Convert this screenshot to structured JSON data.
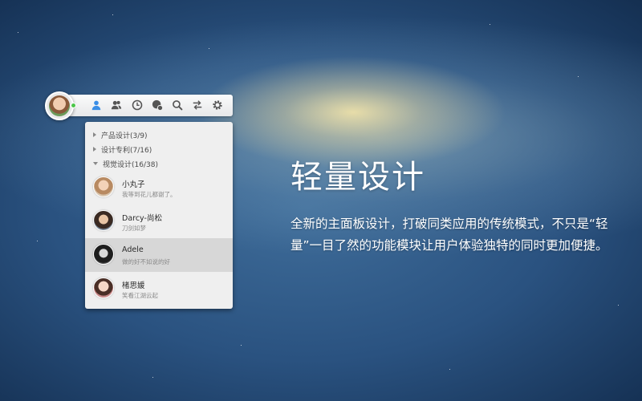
{
  "toolbar": {
    "icons": [
      "contacts-icon",
      "groups-icon",
      "recent-icon",
      "messages-icon",
      "search-icon",
      "switch-icon",
      "settings-icon"
    ],
    "status": "online",
    "active_color": "#3a8ee6"
  },
  "panel": {
    "groups": [
      {
        "label": "产品设计(3/9)",
        "expanded": false
      },
      {
        "label": "设计专利(7/16)",
        "expanded": false
      },
      {
        "label": "视觉设计(16/38)",
        "expanded": true
      }
    ],
    "contacts": [
      {
        "name": "小丸子",
        "signature": "我等到花儿都谢了。",
        "selected": false
      },
      {
        "name": "Darcy-尚松",
        "signature": "刀剑如梦",
        "selected": false
      },
      {
        "name": "Adele",
        "signature": "做的好不如说的好",
        "selected": true
      },
      {
        "name": "楮思媛",
        "signature": "笑看江湖云起",
        "selected": false
      }
    ]
  },
  "promo": {
    "headline": "轻量设计",
    "description": "全新的主面板设计，打破同类应用的传统模式，不只是“轻量”一目了然的功能模块让用户体验独特的同时更加便捷。"
  }
}
